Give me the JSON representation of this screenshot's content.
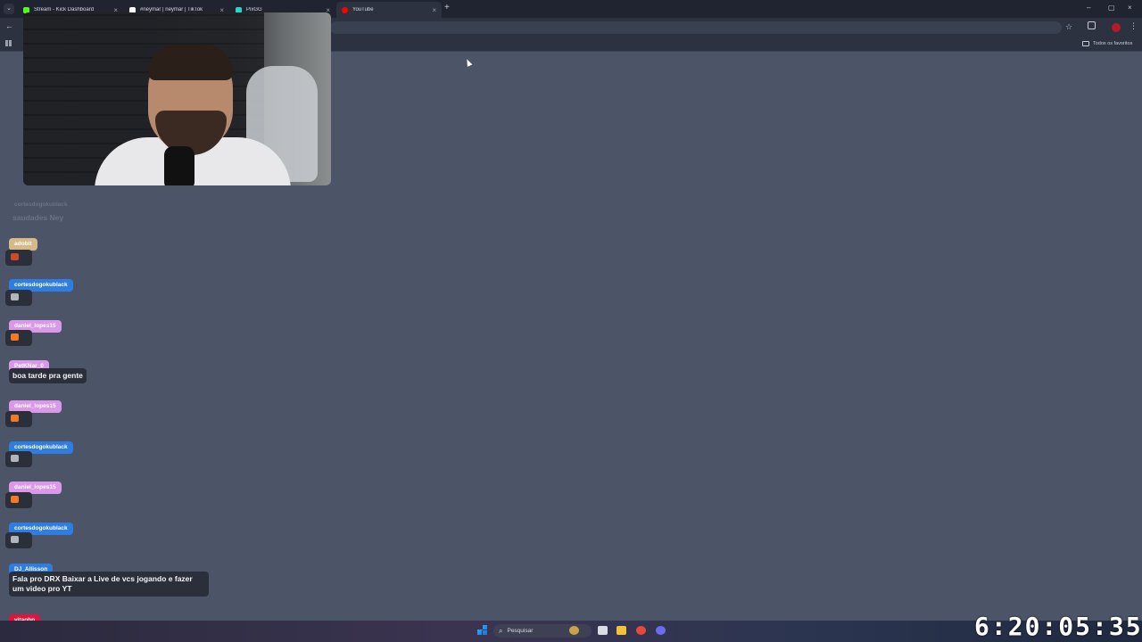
{
  "tabs": [
    {
      "label": "Stream - Kick Dashboard",
      "color": "#53fc18",
      "close": "×"
    },
    {
      "label": "#neymar | neymar | TikTok",
      "color": "#ffffff",
      "close": "×"
    },
    {
      "label": "PixGG",
      "color": "#2bd3c8",
      "close": "×"
    },
    {
      "label": "YouTube",
      "color": "#ff0000",
      "close": "×",
      "active": true
    }
  ],
  "new_tab": "+",
  "window_controls": {
    "minimize": "–",
    "maximize": "▢",
    "close": "×"
  },
  "bookmarks_folder": "Todos os favoritos",
  "chat": [
    {
      "user": "cortesdogokublack",
      "text": "saudades Ney",
      "ghost": true
    },
    {
      "user": "adobit",
      "color": "#d6b98a",
      "emote": "#c94b2c"
    },
    {
      "user": "cortesdogokublack",
      "color": "#2f7de0",
      "emote": "#b0b4bb"
    },
    {
      "user": "daniel_lopes15",
      "color": "#d999e8",
      "emote": "#f07a2a"
    },
    {
      "user": "PetKNar_0",
      "color": "#d999e8",
      "text": "boa tarde pra gente"
    },
    {
      "user": "daniel_lopes15",
      "color": "#d999e8",
      "emote": "#f07a2a"
    },
    {
      "user": "cortesdogokublack",
      "color": "#2f7de0",
      "emote": "#b0b4bb"
    },
    {
      "user": "daniel_lopes15",
      "color": "#d999e8",
      "emote": "#f07a2a"
    },
    {
      "user": "cortesdogokublack",
      "color": "#2f7de0",
      "emote": "#b0b4bb"
    },
    {
      "user": "DJ_Allisson",
      "color": "#2f7de0",
      "text": "Fala pro DRX Baixar a Live de vcs jogando e fazer um video pro YT"
    },
    {
      "user": "vitaobp",
      "color": "#e0143c",
      "emote": "#b0b4bb"
    }
  ],
  "taskbar": {
    "search_placeholder": "Pesquisar"
  },
  "clock": "6:20:05:35",
  "colors": {
    "page_bg": "#4c5568",
    "chrome_bg": "#2c3240",
    "tabstrip_bg": "#1f2430"
  }
}
